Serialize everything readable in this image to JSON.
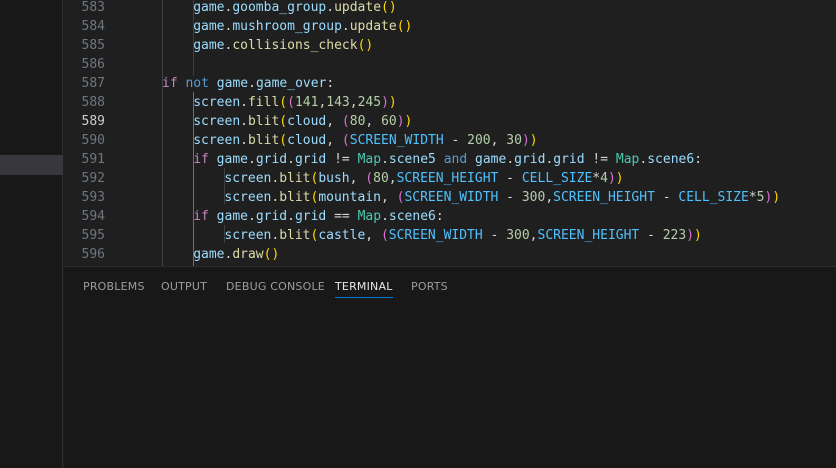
{
  "editor": {
    "current_line": "589",
    "lines": [
      {
        "num": "583",
        "indent": 2,
        "tokens": [
          {
            "t": "game",
            "c": "var"
          },
          {
            "t": ".",
            "c": "plain"
          },
          {
            "t": "goomba_group",
            "c": "var"
          },
          {
            "t": ".",
            "c": "plain"
          },
          {
            "t": "update",
            "c": "func"
          },
          {
            "t": "()",
            "c": "b1"
          }
        ]
      },
      {
        "num": "584",
        "indent": 2,
        "tokens": [
          {
            "t": "game",
            "c": "var"
          },
          {
            "t": ".",
            "c": "plain"
          },
          {
            "t": "mushroom_group",
            "c": "var"
          },
          {
            "t": ".",
            "c": "plain"
          },
          {
            "t": "update",
            "c": "func"
          },
          {
            "t": "()",
            "c": "b1"
          }
        ]
      },
      {
        "num": "585",
        "indent": 2,
        "tokens": [
          {
            "t": "game",
            "c": "var"
          },
          {
            "t": ".",
            "c": "plain"
          },
          {
            "t": "collisions_check",
            "c": "func"
          },
          {
            "t": "()",
            "c": "b1"
          }
        ]
      },
      {
        "num": "586",
        "indent": 0,
        "tokens": []
      },
      {
        "num": "587",
        "indent": 1,
        "tokens": [
          {
            "t": "if",
            "c": "ctrl"
          },
          {
            "t": " ",
            "c": "plain"
          },
          {
            "t": "not",
            "c": "kw"
          },
          {
            "t": " ",
            "c": "plain"
          },
          {
            "t": "game",
            "c": "var"
          },
          {
            "t": ".",
            "c": "plain"
          },
          {
            "t": "game_over",
            "c": "var"
          },
          {
            "t": ":",
            "c": "plain"
          }
        ]
      },
      {
        "num": "588",
        "indent": 2,
        "tokens": [
          {
            "t": "screen",
            "c": "var"
          },
          {
            "t": ".",
            "c": "plain"
          },
          {
            "t": "fill",
            "c": "func"
          },
          {
            "t": "(",
            "c": "b1"
          },
          {
            "t": "(",
            "c": "b2"
          },
          {
            "t": "141",
            "c": "num"
          },
          {
            "t": ",",
            "c": "plain"
          },
          {
            "t": "143",
            "c": "num"
          },
          {
            "t": ",",
            "c": "plain"
          },
          {
            "t": "245",
            "c": "num"
          },
          {
            "t": ")",
            "c": "b2"
          },
          {
            "t": ")",
            "c": "b1"
          }
        ]
      },
      {
        "num": "589",
        "indent": 2,
        "tokens": [
          {
            "t": "screen",
            "c": "var"
          },
          {
            "t": ".",
            "c": "plain"
          },
          {
            "t": "blit",
            "c": "func"
          },
          {
            "t": "(",
            "c": "b1"
          },
          {
            "t": "cloud",
            "c": "var"
          },
          {
            "t": ", ",
            "c": "plain"
          },
          {
            "t": "(",
            "c": "b2"
          },
          {
            "t": "80",
            "c": "num"
          },
          {
            "t": ", ",
            "c": "plain"
          },
          {
            "t": "60",
            "c": "num"
          },
          {
            "t": ")",
            "c": "b2"
          },
          {
            "t": ")",
            "c": "b1"
          }
        ]
      },
      {
        "num": "590",
        "indent": 2,
        "tokens": [
          {
            "t": "screen",
            "c": "var"
          },
          {
            "t": ".",
            "c": "plain"
          },
          {
            "t": "blit",
            "c": "func"
          },
          {
            "t": "(",
            "c": "b1"
          },
          {
            "t": "cloud",
            "c": "var"
          },
          {
            "t": ", ",
            "c": "plain"
          },
          {
            "t": "(",
            "c": "b2"
          },
          {
            "t": "SCREEN_WIDTH",
            "c": "const"
          },
          {
            "t": " - ",
            "c": "plain"
          },
          {
            "t": "200",
            "c": "num"
          },
          {
            "t": ", ",
            "c": "plain"
          },
          {
            "t": "30",
            "c": "num"
          },
          {
            "t": ")",
            "c": "b2"
          },
          {
            "t": ")",
            "c": "b1"
          }
        ]
      },
      {
        "num": "591",
        "indent": 2,
        "tokens": [
          {
            "t": "if",
            "c": "ctrl"
          },
          {
            "t": " ",
            "c": "plain"
          },
          {
            "t": "game",
            "c": "var"
          },
          {
            "t": ".",
            "c": "plain"
          },
          {
            "t": "grid",
            "c": "var"
          },
          {
            "t": ".",
            "c": "plain"
          },
          {
            "t": "grid",
            "c": "var"
          },
          {
            "t": " != ",
            "c": "plain"
          },
          {
            "t": "Map",
            "c": "class"
          },
          {
            "t": ".",
            "c": "plain"
          },
          {
            "t": "scene5",
            "c": "var"
          },
          {
            "t": " ",
            "c": "plain"
          },
          {
            "t": "and",
            "c": "kw"
          },
          {
            "t": " ",
            "c": "plain"
          },
          {
            "t": "game",
            "c": "var"
          },
          {
            "t": ".",
            "c": "plain"
          },
          {
            "t": "grid",
            "c": "var"
          },
          {
            "t": ".",
            "c": "plain"
          },
          {
            "t": "grid",
            "c": "var"
          },
          {
            "t": " != ",
            "c": "plain"
          },
          {
            "t": "Map",
            "c": "class"
          },
          {
            "t": ".",
            "c": "plain"
          },
          {
            "t": "scene6",
            "c": "var"
          },
          {
            "t": ":",
            "c": "plain"
          }
        ]
      },
      {
        "num": "592",
        "indent": 3,
        "tokens": [
          {
            "t": "screen",
            "c": "var"
          },
          {
            "t": ".",
            "c": "plain"
          },
          {
            "t": "blit",
            "c": "func"
          },
          {
            "t": "(",
            "c": "b1"
          },
          {
            "t": "bush",
            "c": "var"
          },
          {
            "t": ", ",
            "c": "plain"
          },
          {
            "t": "(",
            "c": "b2"
          },
          {
            "t": "80",
            "c": "num"
          },
          {
            "t": ",",
            "c": "plain"
          },
          {
            "t": "SCREEN_HEIGHT",
            "c": "const"
          },
          {
            "t": " - ",
            "c": "plain"
          },
          {
            "t": "CELL_SIZE",
            "c": "const"
          },
          {
            "t": "*",
            "c": "plain"
          },
          {
            "t": "4",
            "c": "num"
          },
          {
            "t": ")",
            "c": "b2"
          },
          {
            "t": ")",
            "c": "b1"
          }
        ]
      },
      {
        "num": "593",
        "indent": 3,
        "tokens": [
          {
            "t": "screen",
            "c": "var"
          },
          {
            "t": ".",
            "c": "plain"
          },
          {
            "t": "blit",
            "c": "func"
          },
          {
            "t": "(",
            "c": "b1"
          },
          {
            "t": "mountain",
            "c": "var"
          },
          {
            "t": ", ",
            "c": "plain"
          },
          {
            "t": "(",
            "c": "b2"
          },
          {
            "t": "SCREEN_WIDTH",
            "c": "const"
          },
          {
            "t": " - ",
            "c": "plain"
          },
          {
            "t": "300",
            "c": "num"
          },
          {
            "t": ",",
            "c": "plain"
          },
          {
            "t": "SCREEN_HEIGHT",
            "c": "const"
          },
          {
            "t": " - ",
            "c": "plain"
          },
          {
            "t": "CELL_SIZE",
            "c": "const"
          },
          {
            "t": "*",
            "c": "plain"
          },
          {
            "t": "5",
            "c": "num"
          },
          {
            "t": ")",
            "c": "b2"
          },
          {
            "t": ")",
            "c": "b1"
          }
        ]
      },
      {
        "num": "594",
        "indent": 2,
        "tokens": [
          {
            "t": "if",
            "c": "ctrl"
          },
          {
            "t": " ",
            "c": "plain"
          },
          {
            "t": "game",
            "c": "var"
          },
          {
            "t": ".",
            "c": "plain"
          },
          {
            "t": "grid",
            "c": "var"
          },
          {
            "t": ".",
            "c": "plain"
          },
          {
            "t": "grid",
            "c": "var"
          },
          {
            "t": " == ",
            "c": "plain"
          },
          {
            "t": "Map",
            "c": "class"
          },
          {
            "t": ".",
            "c": "plain"
          },
          {
            "t": "scene6",
            "c": "var"
          },
          {
            "t": ":",
            "c": "plain"
          }
        ]
      },
      {
        "num": "595",
        "indent": 3,
        "tokens": [
          {
            "t": "screen",
            "c": "var"
          },
          {
            "t": ".",
            "c": "plain"
          },
          {
            "t": "blit",
            "c": "func"
          },
          {
            "t": "(",
            "c": "b1"
          },
          {
            "t": "castle",
            "c": "var"
          },
          {
            "t": ", ",
            "c": "plain"
          },
          {
            "t": "(",
            "c": "b2"
          },
          {
            "t": "SCREEN_WIDTH",
            "c": "const"
          },
          {
            "t": " - ",
            "c": "plain"
          },
          {
            "t": "300",
            "c": "num"
          },
          {
            "t": ",",
            "c": "plain"
          },
          {
            "t": "SCREEN_HEIGHT",
            "c": "const"
          },
          {
            "t": " - ",
            "c": "plain"
          },
          {
            "t": "223",
            "c": "num"
          },
          {
            "t": ")",
            "c": "b2"
          },
          {
            "t": ")",
            "c": "b1"
          }
        ]
      },
      {
        "num": "596",
        "indent": 2,
        "tokens": [
          {
            "t": "game",
            "c": "var"
          },
          {
            "t": ".",
            "c": "plain"
          },
          {
            "t": "draw",
            "c": "func"
          },
          {
            "t": "()",
            "c": "b1"
          }
        ]
      }
    ]
  },
  "panel": {
    "tabs": [
      {
        "label": "PROBLEMS",
        "active": false
      },
      {
        "label": "OUTPUT",
        "active": false
      },
      {
        "label": "DEBUG CONSOLE",
        "active": false
      },
      {
        "label": "TERMINAL",
        "active": true
      },
      {
        "label": "PORTS",
        "active": false
      }
    ]
  },
  "theme": {
    "var": "#9cdcfe",
    "func": "#dcdcaa",
    "kw": "#569cd6",
    "ctrl": "#c586c0",
    "num": "#b5cea8",
    "const": "#4fc1ff",
    "class": "#4ec9b0",
    "plain": "#d4d4d4",
    "b1": "#ffd700",
    "b2": "#da70d6"
  }
}
